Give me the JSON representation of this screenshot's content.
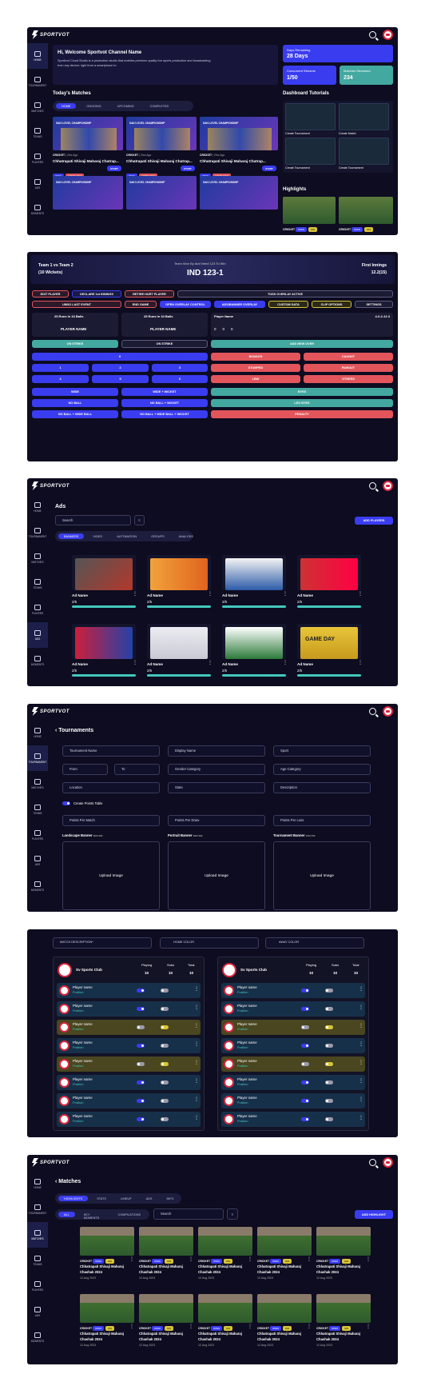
{
  "app": {
    "name": "SPORTVOT"
  },
  "nav": [
    "HOME",
    "TOURNAMENT",
    "MATCHES",
    "TEAMS",
    "PLAYERS",
    "ADS",
    "MOMENTS"
  ],
  "home": {
    "welcome_title": "Hi, Welcome Sportvot Channel Name",
    "welcome_text_1": "Sportivot Cloud Studio is a production studio that enables premium quality live sports production and broadcasting",
    "welcome_text_2": "from any device; right from a smartphone to",
    "stats": [
      {
        "label": "Days Remaining",
        "value": "28 Days"
      },
      {
        "label": "Concurrent Streams",
        "value": "1/50"
      },
      {
        "label": "Matches Streamed",
        "value": "234"
      }
    ],
    "todays_matches": "Today's Matches",
    "tabs": [
      "HOME",
      "ONGOING",
      "UPCOMING",
      "COMPLETED"
    ],
    "match_cards": [
      {
        "sport": "CRICKET",
        "time": "2hrs Ago",
        "title": "Chhatrapati Shivaji Maharaj Chatrap...",
        "badges": [
          "OPEN",
          "COMPLETED"
        ],
        "action": "START"
      },
      {
        "sport": "CRICKET",
        "time": "2hrs Ago",
        "title": "Chhatrapati Shivaji Maharaj Chatrap...",
        "badges": [
          "OPEN",
          "COMPLETED"
        ],
        "action": "START"
      },
      {
        "sport": "CRICKET",
        "time": "2hrs Ago",
        "title": "Chhatrapati Shivaji Maharaj Chatrap...",
        "badges": [
          "OPEN",
          "COMPLETED"
        ],
        "action": "START"
      }
    ],
    "tutorials_title": "Dashboard Tutorials",
    "tutorials": [
      "Create Tournament",
      "Create Match",
      "Create Tournament",
      "Create Tournament"
    ],
    "highlights_title": "Highlights",
    "highlight_sport": "CRICKET",
    "highlight_badges": [
      "OPEN",
      "U21"
    ]
  },
  "scoring": {
    "team_line": "Team 1 vs Team 2",
    "wickets": "(10 Wickets)",
    "need": "Team Won By Abd Need 123 To Win",
    "score": "IND 123-1",
    "innings": "First Innings",
    "overs": "12.2(15)",
    "row1": [
      "EDIT PLAYER",
      "DECLARE 1st INNINGS",
      "RETIRE HURT PLAYER",
      "TOSS OVERLAY ACTIVE"
    ],
    "row2": [
      "UNDO LAST EVENT",
      "END GAME",
      "OPEN OVERLAY CONTROL",
      "ADS/BANNER OVERLAY",
      "CUSTOM DATA",
      "CLIP OPTIONS",
      "SETTINGS"
    ],
    "runs1": "25 Runs In 34 Balls",
    "runs2": "25 Runs In 34 Balls",
    "player_name": "PLAYER NAME",
    "strike": "ON STRIKE",
    "off_strike": "ON STRIKE",
    "bowler_label": "Player Name",
    "bowler_figures": "4-0-2-12.3",
    "bowler_balls": [
      "0",
      "0",
      "0"
    ],
    "add_bowler": "ADD NEW OVER",
    "run_main": "0",
    "run_grid": [
      "1",
      "2",
      "3",
      "4",
      "5",
      "6"
    ],
    "extras_left": [
      "WIDE",
      "WIDE + WICKET",
      "NO BALL",
      "NO BALL + WICKET",
      "NO BALL + WIDE BALL",
      "NO BALL + WIDE BALL + WICKET"
    ],
    "outs": [
      "BOWLED",
      "CAUGHT",
      "STUMPED",
      "RUNOUT",
      "LBW",
      "OTHERS"
    ],
    "extras_right": [
      "BYES",
      "LEG BYES",
      "PENALTY"
    ]
  },
  "ads": {
    "title": "Ads",
    "search_placeholder": "Search",
    "add_button": "ADD PLAYERS",
    "tabs": [
      "BANNERS",
      "VIDEO",
      "AUTOMATION",
      "GROUPS",
      "ANALYSIS"
    ],
    "cards": [
      {
        "name": "Ad Name",
        "count": "2/5"
      },
      {
        "name": "Ad Name",
        "count": "2/5"
      },
      {
        "name": "Ad Name",
        "count": "2/5"
      },
      {
        "name": "Ad Name",
        "count": "2/5"
      },
      {
        "name": "Ad Name",
        "count": "2/5"
      },
      {
        "name": "Ad Name",
        "count": "2/5"
      },
      {
        "name": "Ad Name",
        "count": "2/5"
      },
      {
        "name": "Ad Name",
        "count": "2/5"
      }
    ],
    "gameday_text": "GAME DAY"
  },
  "tournament": {
    "title": "Tournaments",
    "fields": {
      "name": "Tournament Name",
      "display": "Display Name",
      "sport": "Sport",
      "from": "From",
      "to": "To",
      "gender": "Gender Category",
      "age": "Age Category",
      "location": "Location",
      "state": "State",
      "description": "Description",
      "points_table": "Create Points Table",
      "ppm": "Points Per Match",
      "ppd": "Points Per Draw",
      "ppl": "Points Per Loss"
    },
    "banners": [
      {
        "label": "Landscape Banner",
        "size": "360×490"
      },
      {
        "label": "Portrait Banner",
        "size": "360×490"
      },
      {
        "label": "Tournament Banner",
        "size": "400×400"
      }
    ],
    "upload": "Upload Image"
  },
  "lineup": {
    "description": "MATCH DESCRIPTION*",
    "home_color": "HOME COLOR",
    "away_color": "AWAY COLOR",
    "team": "Sv Sports Club",
    "headers": [
      "Playing",
      "Subs",
      "Total"
    ],
    "counts": [
      "10",
      "10",
      "10"
    ],
    "player": "Player name",
    "position": "Position"
  },
  "matches": {
    "title": "Matches",
    "tabs": [
      "HIGHLIGHTS",
      "STATS",
      "LINEUP",
      "ADS",
      "INFO"
    ],
    "filters": [
      "ALL",
      "KEY MOMENTS",
      "COMPILATIONS"
    ],
    "search_placeholder": "Search",
    "add_button": "ADD HIGHLIGHT",
    "card": {
      "sport": "CRICKET",
      "badges": [
        "OPEN",
        "U21"
      ],
      "title1": "Chhatrapati Shivaji Maharaj",
      "title2": "Chashak 2024",
      "date": "12 Aug 2023"
    }
  }
}
